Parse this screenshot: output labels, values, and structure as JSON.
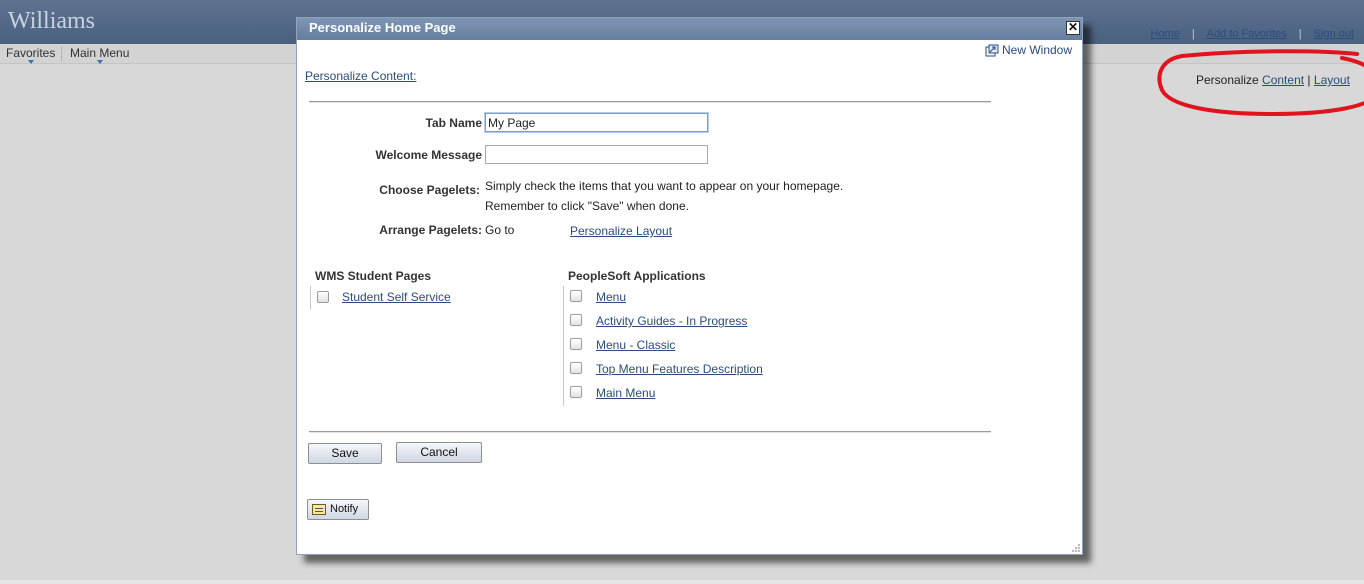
{
  "app": {
    "brand": "Williams",
    "toplinks": [
      "Home",
      "Add to Favorites",
      "Sign out"
    ],
    "menubar": {
      "favorites": "Favorites",
      "main_menu": "Main Menu"
    },
    "personalize": {
      "label": "Personalize",
      "content": "Content",
      "sep": "|",
      "layout": "Layout"
    }
  },
  "modal": {
    "title": "Personalize Home Page",
    "close_glyph": "✕",
    "new_window": "New Window",
    "personalize_content": "Personalize Content:",
    "tab_name_label": "Tab Name",
    "tab_name_value": "My Page",
    "welcome_label": "Welcome Message",
    "welcome_value": "",
    "choose_label": "Choose Pagelets:",
    "choose_text_1": "Simply check the items that you want to appear on your homepage.",
    "choose_text_2": "Remember to click \"Save\" when done.",
    "arrange_label": "Arrange Pagelets:",
    "arrange_goto": "Go to",
    "arrange_link": "Personalize Layout",
    "wms_heading": "WMS Student Pages",
    "wms_items": [
      "Student Self Service"
    ],
    "ps_heading": "PeopleSoft Applications",
    "ps_items": [
      "Menu",
      "Activity Guides - In Progress",
      "Menu - Classic",
      "Top Menu Features Description",
      "Main Menu"
    ],
    "save": "Save",
    "cancel": "Cancel",
    "notify": "Notify"
  },
  "colors": {
    "title_bar": "#7089a8",
    "link": "#2a4d7f",
    "annotation": "#e0141e"
  }
}
